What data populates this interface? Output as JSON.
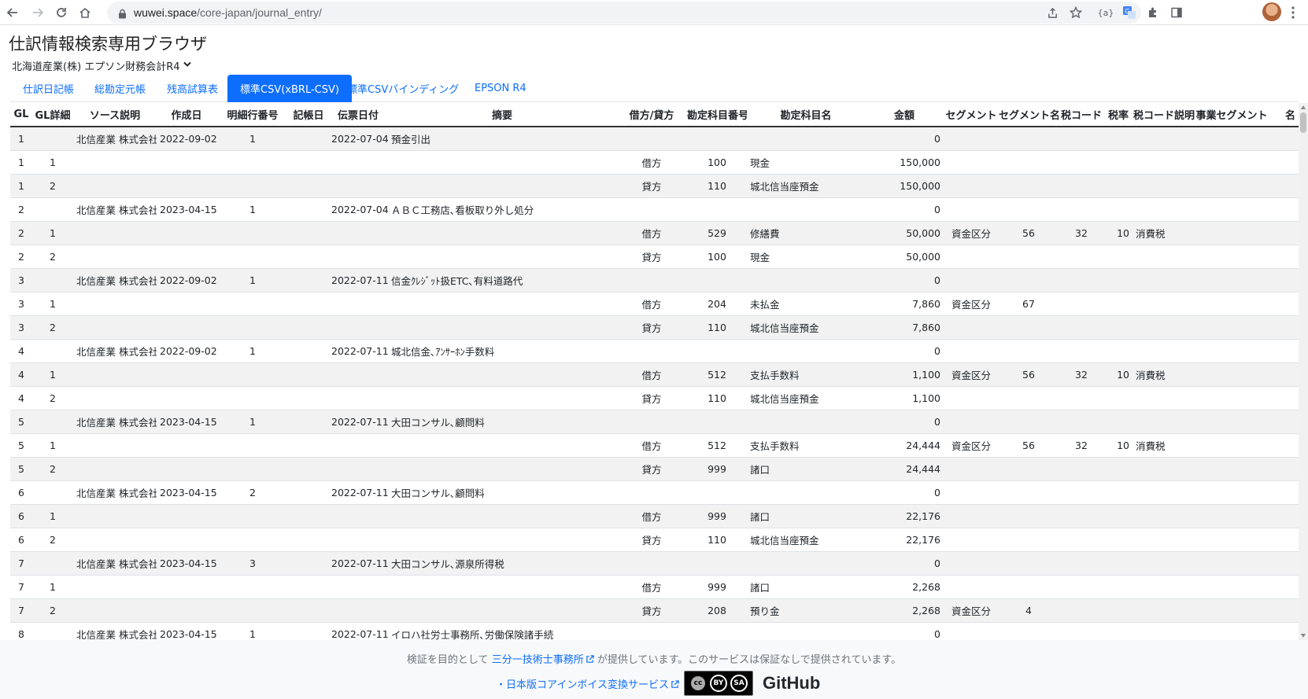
{
  "browser": {
    "url_host": "wuwei.space",
    "url_path": "/core-japan/journal_entry/"
  },
  "page": {
    "title": "仕訳情報検索専用ブラウザ",
    "company_selected": "北海道産業(株) エプソン財務会計R4"
  },
  "tabs": [
    {
      "label": "仕訳日記帳",
      "active": false
    },
    {
      "label": "総勘定元帳",
      "active": false
    },
    {
      "label": "残高試算表",
      "active": false
    },
    {
      "label": "標準CSV(xBRL-CSV)",
      "active": true
    },
    {
      "label": "標準CSVバインディング",
      "active": false
    },
    {
      "label": "EPSON R4",
      "active": false
    }
  ],
  "table": {
    "headers": [
      "GL",
      "GL詳細",
      "ソース説明",
      "作成日",
      "明細行番号",
      "記帳日",
      "伝票日付",
      "摘要",
      "借方/貸方",
      "勘定科目番号",
      "勘定科目名",
      "金額",
      "セグメント",
      "セグメント名",
      "税コード",
      "税率",
      "税コード説明",
      "事業セグメント",
      "名"
    ],
    "rows": [
      [
        "1",
        "",
        "北信産業 株式会社",
        "2022-09-02",
        "1",
        "",
        "2022-07-04",
        "預金引出",
        "",
        "",
        "",
        "0",
        "",
        "",
        "",
        "",
        "",
        "",
        ""
      ],
      [
        "1",
        "1",
        "",
        "",
        "",
        "",
        "",
        "",
        "借方",
        "100",
        "現金",
        "150,000",
        "",
        "",
        "",
        "",
        "",
        "",
        ""
      ],
      [
        "1",
        "2",
        "",
        "",
        "",
        "",
        "",
        "",
        "貸方",
        "110",
        "城北信当座預金",
        "150,000",
        "",
        "",
        "",
        "",
        "",
        "",
        ""
      ],
      [
        "2",
        "",
        "北信産業 株式会社",
        "2023-04-15",
        "1",
        "",
        "2022-07-04",
        "ＡＢＣ工務店､看板取り外し処分",
        "",
        "",
        "",
        "0",
        "",
        "",
        "",
        "",
        "",
        "",
        ""
      ],
      [
        "2",
        "1",
        "",
        "",
        "",
        "",
        "",
        "",
        "借方",
        "529",
        "修繕費",
        "50,000",
        "資金区分",
        "56",
        "32",
        "10",
        "消費税",
        "",
        ""
      ],
      [
        "2",
        "2",
        "",
        "",
        "",
        "",
        "",
        "",
        "貸方",
        "100",
        "現金",
        "50,000",
        "",
        "",
        "",
        "",
        "",
        "",
        ""
      ],
      [
        "3",
        "",
        "北信産業 株式会社",
        "2022-09-02",
        "1",
        "",
        "2022-07-11",
        "信金ｸﾚｼﾞｯﾄ扱ETC､有料道路代",
        "",
        "",
        "",
        "0",
        "",
        "",
        "",
        "",
        "",
        "",
        ""
      ],
      [
        "3",
        "1",
        "",
        "",
        "",
        "",
        "",
        "",
        "借方",
        "204",
        "未払金",
        "7,860",
        "資金区分",
        "67",
        "",
        "",
        "",
        "",
        ""
      ],
      [
        "3",
        "2",
        "",
        "",
        "",
        "",
        "",
        "",
        "貸方",
        "110",
        "城北信当座預金",
        "7,860",
        "",
        "",
        "",
        "",
        "",
        "",
        ""
      ],
      [
        "4",
        "",
        "北信産業 株式会社",
        "2022-09-02",
        "1",
        "",
        "2022-07-11",
        "城北信金､ｱﾝｻｰﾎﾝ手数料",
        "",
        "",
        "",
        "0",
        "",
        "",
        "",
        "",
        "",
        "",
        ""
      ],
      [
        "4",
        "1",
        "",
        "",
        "",
        "",
        "",
        "",
        "借方",
        "512",
        "支払手数料",
        "1,100",
        "資金区分",
        "56",
        "32",
        "10",
        "消費税",
        "",
        ""
      ],
      [
        "4",
        "2",
        "",
        "",
        "",
        "",
        "",
        "",
        "貸方",
        "110",
        "城北信当座預金",
        "1,100",
        "",
        "",
        "",
        "",
        "",
        "",
        ""
      ],
      [
        "5",
        "",
        "北信産業 株式会社",
        "2023-04-15",
        "1",
        "",
        "2022-07-11",
        "大田コンサル､顧問料",
        "",
        "",
        "",
        "0",
        "",
        "",
        "",
        "",
        "",
        "",
        ""
      ],
      [
        "5",
        "1",
        "",
        "",
        "",
        "",
        "",
        "",
        "借方",
        "512",
        "支払手数料",
        "24,444",
        "資金区分",
        "56",
        "32",
        "10",
        "消費税",
        "",
        ""
      ],
      [
        "5",
        "2",
        "",
        "",
        "",
        "",
        "",
        "",
        "貸方",
        "999",
        "諸口",
        "24,444",
        "",
        "",
        "",
        "",
        "",
        "",
        ""
      ],
      [
        "6",
        "",
        "北信産業 株式会社",
        "2023-04-15",
        "2",
        "",
        "2022-07-11",
        "大田コンサル､顧問料",
        "",
        "",
        "",
        "0",
        "",
        "",
        "",
        "",
        "",
        "",
        ""
      ],
      [
        "6",
        "1",
        "",
        "",
        "",
        "",
        "",
        "",
        "借方",
        "999",
        "諸口",
        "22,176",
        "",
        "",
        "",
        "",
        "",
        "",
        ""
      ],
      [
        "6",
        "2",
        "",
        "",
        "",
        "",
        "",
        "",
        "貸方",
        "110",
        "城北信当座預金",
        "22,176",
        "",
        "",
        "",
        "",
        "",
        "",
        ""
      ],
      [
        "7",
        "",
        "北信産業 株式会社",
        "2023-04-15",
        "3",
        "",
        "2022-07-11",
        "大田コンサル､源泉所得税",
        "",
        "",
        "",
        "0",
        "",
        "",
        "",
        "",
        "",
        "",
        ""
      ],
      [
        "7",
        "1",
        "",
        "",
        "",
        "",
        "",
        "",
        "借方",
        "999",
        "諸口",
        "2,268",
        "",
        "",
        "",
        "",
        "",
        "",
        ""
      ],
      [
        "7",
        "2",
        "",
        "",
        "",
        "",
        "",
        "",
        "貸方",
        "208",
        "預り金",
        "2,268",
        "資金区分",
        "4",
        "",
        "",
        "",
        "",
        ""
      ],
      [
        "8",
        "",
        "北信産業 株式会社",
        "2023-04-15",
        "1",
        "",
        "2022-07-11",
        "イロハ社労士事務所､労働保険諸手続",
        "",
        "",
        "",
        "0",
        "",
        "",
        "",
        "",
        "",
        "",
        ""
      ]
    ]
  },
  "footer": {
    "prefix": "検証を目的として",
    "link_office": "三分一技術士事務所",
    "suffix": "が提供しています。このサービスは保証なしで提供されています。",
    "link_service": "・日本版コアインボイス変換サービス",
    "github": "GitHub",
    "cc_by": "BY",
    "cc_sa": "SA",
    "cc_mark": "cc"
  },
  "colors": {
    "accent": "#0d6efd",
    "stripe": "#f2f2f2",
    "footer_bg": "#f8f9fa"
  }
}
